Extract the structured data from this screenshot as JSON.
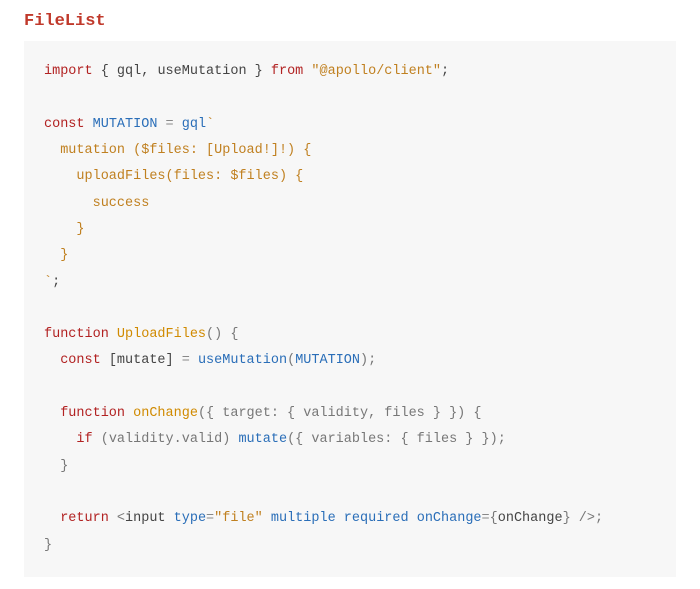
{
  "title": "FileList",
  "code": {
    "l1_import": "import",
    "l1_brace_open": " { ",
    "l1_gql": "gql",
    "l1_comma": ", ",
    "l1_useMutation": "useMutation",
    "l1_brace_close": " } ",
    "l1_from": "from",
    "l1_sp": " ",
    "l1_pkg": "\"@apollo/client\"",
    "l1_semi": ";",
    "l3_const": "const",
    "l3_sp": " ",
    "l3_name": "MUTATION",
    "l3_eq": " = ",
    "l3_gql": "gql",
    "l3_bt": "`",
    "l4": "  mutation ($files: [Upload!]!) {",
    "l5": "    uploadFiles(files: $files) {",
    "l6": "      success",
    "l7": "    }",
    "l8": "  }",
    "l9_bt": "`",
    "l9_semi": ";",
    "l11_fn": "function",
    "l11_sp": " ",
    "l11_name": "UploadFiles",
    "l11_par": "() {",
    "l12_indent": "  ",
    "l12_const": "const",
    "l12_sp": " ",
    "l12_br": "[mutate] ",
    "l12_eq": "= ",
    "l12_call": "useMutation",
    "l12_open": "(",
    "l12_arg": "MUTATION",
    "l12_close": ");",
    "l14_indent": "  ",
    "l14_fn": "function",
    "l14_sp": " ",
    "l14_name": "onChange",
    "l14_rest": "({ target: { validity, files } }) {",
    "l15_indent": "    ",
    "l15_if": "if",
    "l15_sp": " ",
    "l15_cond_open": "(validity.valid) ",
    "l15_call": "mutate",
    "l15_rest": "({ variables: { files } });",
    "l16": "  }",
    "l18_indent": "  ",
    "l18_return": "return",
    "l18_sp": " ",
    "l18_lt": "<",
    "l18_tag": "input ",
    "l18_type": "type",
    "l18_eq": "=",
    "l18_typeval": "\"file\"",
    "l18_sp2": " ",
    "l18_multiple": "multiple",
    "l18_sp3": " ",
    "l18_required": "required",
    "l18_sp4": " ",
    "l18_onchange": "onChange",
    "l18_eq2": "=",
    "l18_brace_open": "{",
    "l18_handler": "onChange",
    "l18_brace_close": "}",
    "l18_end": " />;",
    "l19": "}"
  }
}
